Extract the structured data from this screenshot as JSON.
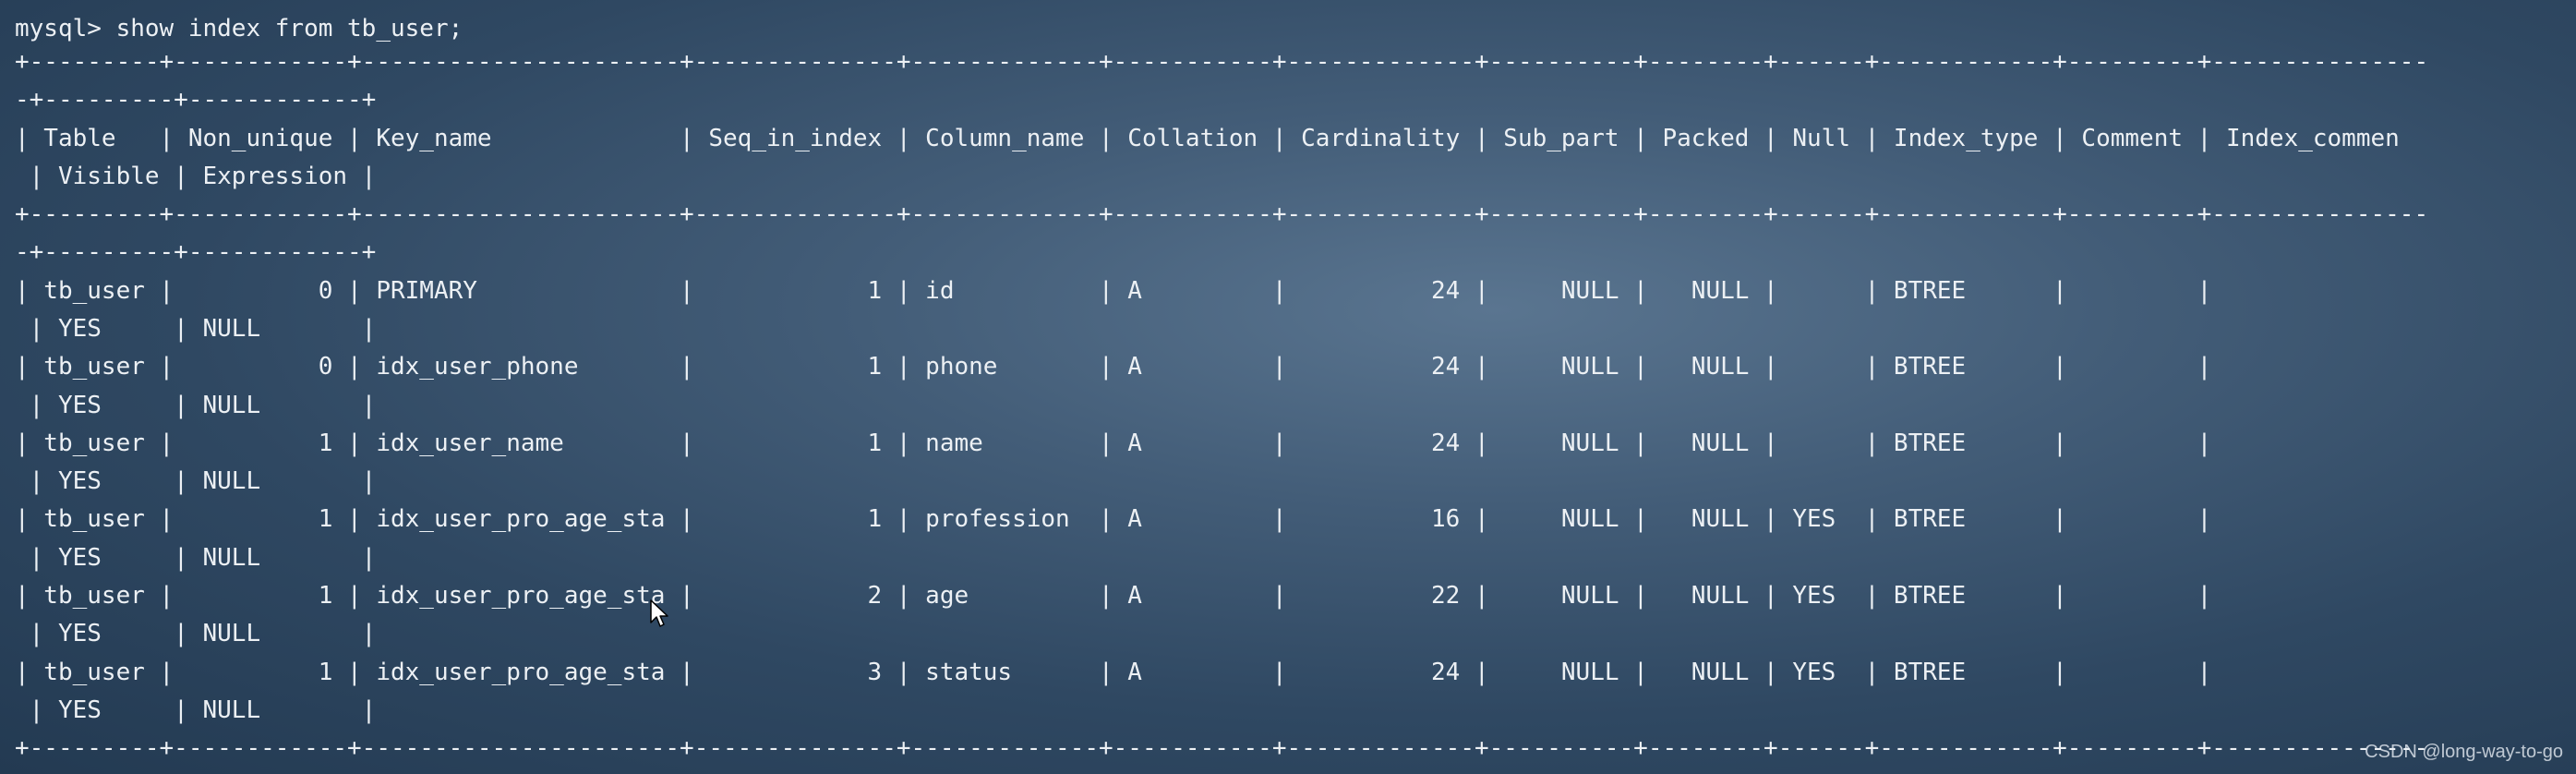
{
  "terminal": {
    "prompt": "mysql>",
    "command": "show index from tb_user;",
    "lines": [
      "mysql> show index from tb_user;",
      "+---------+------------+----------------------+--------------+-------------+-----------+-------------+----------+--------+------+------------+---------+---------------",
      "-+---------+------------+",
      "| Table   | Non_unique | Key_name             | Seq_in_index | Column_name | Collation | Cardinality | Sub_part | Packed | Null | Index_type | Comment | Index_commen",
      " | Visible | Expression |",
      "+---------+------------+----------------------+--------------+-------------+-----------+-------------+----------+--------+------+------------+---------+---------------",
      "-+---------+------------+",
      "| tb_user |          0 | PRIMARY              |            1 | id          | A         |          24 |     NULL |   NULL |      | BTREE      |         |",
      " | YES     | NULL       |",
      "| tb_user |          0 | idx_user_phone       |            1 | phone       | A         |          24 |     NULL |   NULL |      | BTREE      |         |",
      " | YES     | NULL       |",
      "| tb_user |          1 | idx_user_name        |            1 | name        | A         |          24 |     NULL |   NULL |      | BTREE      |         |",
      " | YES     | NULL       |",
      "| tb_user |          1 | idx_user_pro_age_sta |            1 | profession  | A         |          16 |     NULL |   NULL | YES  | BTREE      |         |",
      " | YES     | NULL       |",
      "| tb_user |          1 | idx_user_pro_age_sta |            2 | age         | A         |          22 |     NULL |   NULL | YES  | BTREE      |         |",
      " | YES     | NULL       |",
      "| tb_user |          1 | idx_user_pro_age_sta |            3 | status      | A         |          24 |     NULL |   NULL | YES  | BTREE      |         |",
      " | YES     | NULL       |",
      "+---------+------------+----------------------+--------------+-------------+-----------+-------------+----------+--------+------+------------+---------+---------------"
    ]
  },
  "watermark": "CSDN @long-way-to-go",
  "colors": {
    "text": "#ecf0f4",
    "background": "#3b556f"
  }
}
